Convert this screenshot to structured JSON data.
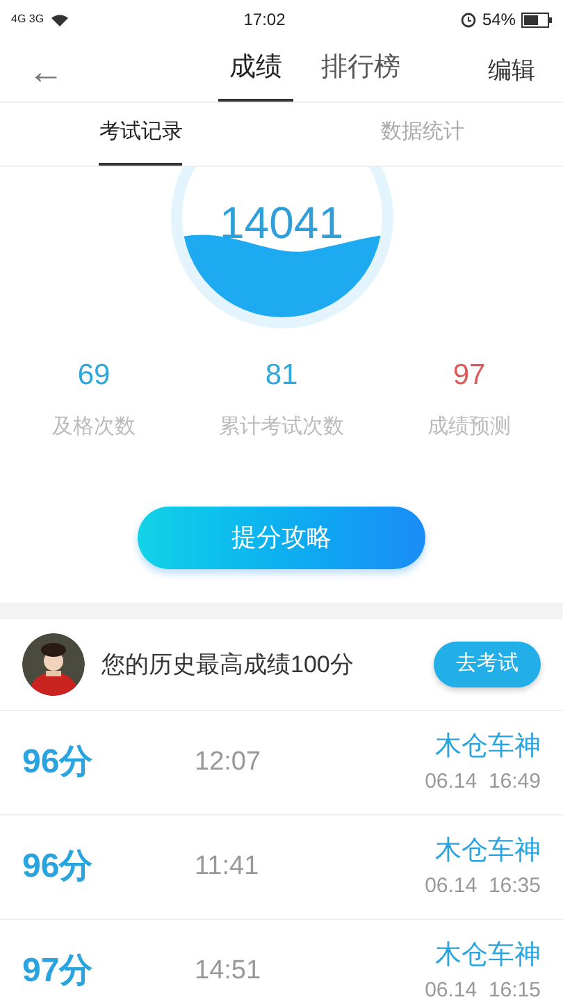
{
  "status_bar": {
    "network": "4G 3G",
    "time": "17:02",
    "battery": "54%"
  },
  "header": {
    "back": "←",
    "tabs": [
      {
        "label": "成绩",
        "selected": true
      },
      {
        "label": "排行榜",
        "selected": false
      }
    ],
    "action": "编辑"
  },
  "subtabs": [
    {
      "label": "考试记录",
      "selected": true
    },
    {
      "label": "数据统计",
      "selected": false
    }
  ],
  "gauge": {
    "value": "14041"
  },
  "stats": [
    {
      "value": "69",
      "label": "及格次数",
      "color": "#2fa8dc"
    },
    {
      "value": "81",
      "label": "累计考试次数",
      "color": "#2fa8dc"
    },
    {
      "value": "97",
      "label": "成绩预测",
      "color": "#e05a5a"
    }
  ],
  "tips_button": "提分攻略",
  "best": {
    "text": "您的历史最高成绩100分",
    "button": "去考试"
  },
  "records": [
    {
      "score": "96分",
      "duration": "12:07",
      "name": "木仓车神",
      "date": "06.14  16:49"
    },
    {
      "score": "96分",
      "duration": "11:41",
      "name": "木仓车神",
      "date": "06.14  16:35"
    },
    {
      "score": "97分",
      "duration": "14:51",
      "name": "木仓车神",
      "date": "06.14  16:15"
    }
  ]
}
